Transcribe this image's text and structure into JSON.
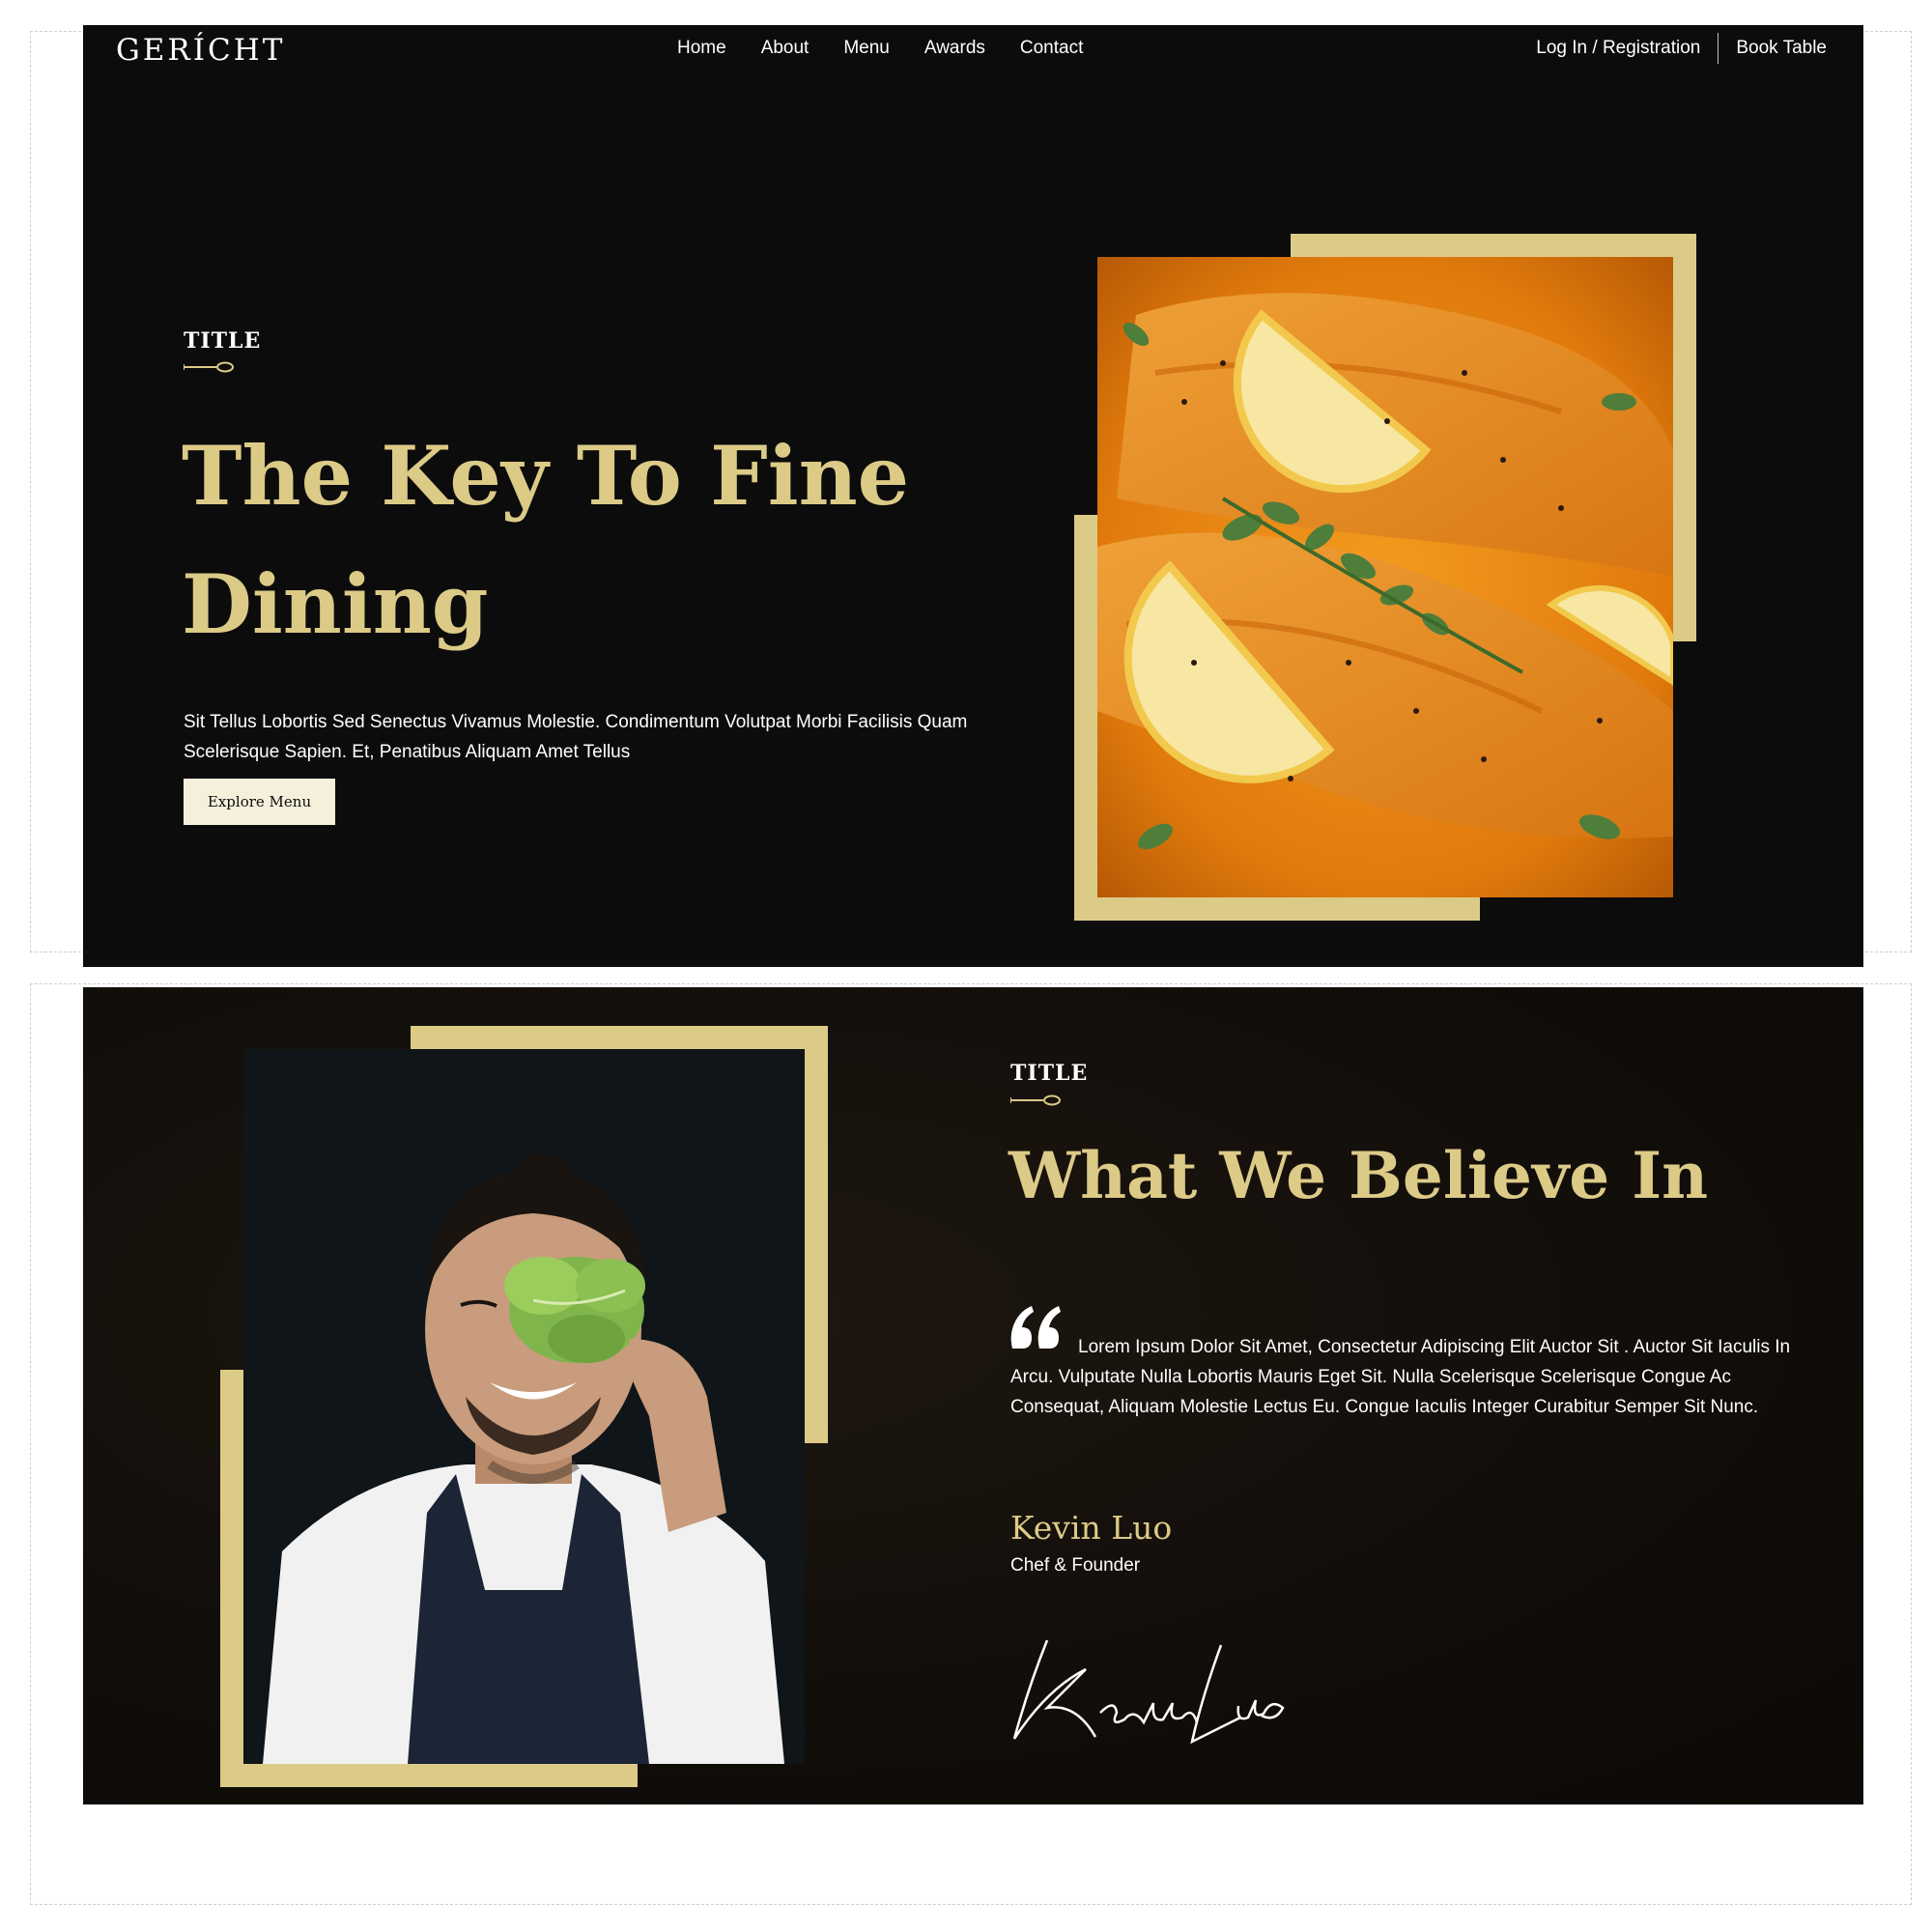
{
  "brand": {
    "logo": "GERÍCHT"
  },
  "nav": {
    "links": [
      "Home",
      "About",
      "Menu",
      "Awards",
      "Contact"
    ],
    "login": "Log In / Registration",
    "book": "Book Table"
  },
  "hero": {
    "eyebrow": "TITLE",
    "title_line1": "The Key To Fine",
    "title_line2": "Dining",
    "description": "Sit Tellus Lobortis Sed Senectus Vivamus Molestie. Condimentum Volutpat Morbi Facilisis Quam Scelerisque Sapien. Et, Penatibus Aliquam Amet Tellus",
    "button": "Explore Menu"
  },
  "about": {
    "eyebrow": "TITLE",
    "title": "What We Believe In",
    "quote": "Lorem Ipsum Dolor Sit Amet, Consectetur Adipiscing Elit Auctor Sit . Auctor Sit Iaculis In Arcu. Vulputate Nulla Lobortis Mauris Eget Sit. Nulla Scelerisque Scelerisque Congue Ac Consequat, Aliquam Molestie Lectus Eu. Congue Iaculis Integer Curabitur Semper Sit Nunc.",
    "chef_name": "Kevin Luo",
    "chef_role": "Chef & Founder",
    "signature": "Kevin Luo"
  },
  "colors": {
    "gold": "#dcca87",
    "dark": "#0c0c0c",
    "cream": "#f5efdb"
  },
  "icons": [
    "spoon-divider-icon",
    "quote-icon"
  ]
}
